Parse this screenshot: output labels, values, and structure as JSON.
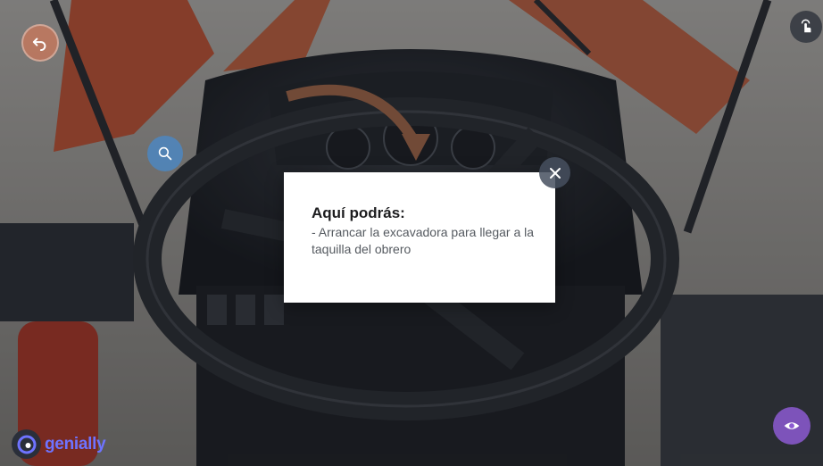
{
  "modal": {
    "title": "Aquí podrás:",
    "body": "- Arrancar la excavadora para llegar a la taquilla del obrero"
  },
  "brand": {
    "name": "genially"
  },
  "icons": {
    "back": "undo-arrow-icon",
    "search": "magnifier-icon",
    "touch": "touch-hand-icon",
    "eye": "eye-icon",
    "close": "close-icon",
    "brand": "genially-logo-icon"
  },
  "colors": {
    "steering": "#2c2f33",
    "arrow": "#b5704a",
    "accent_orange": "#e0532b",
    "search_blue": "#468cd2",
    "eye_purple": "#8c5ad2"
  }
}
